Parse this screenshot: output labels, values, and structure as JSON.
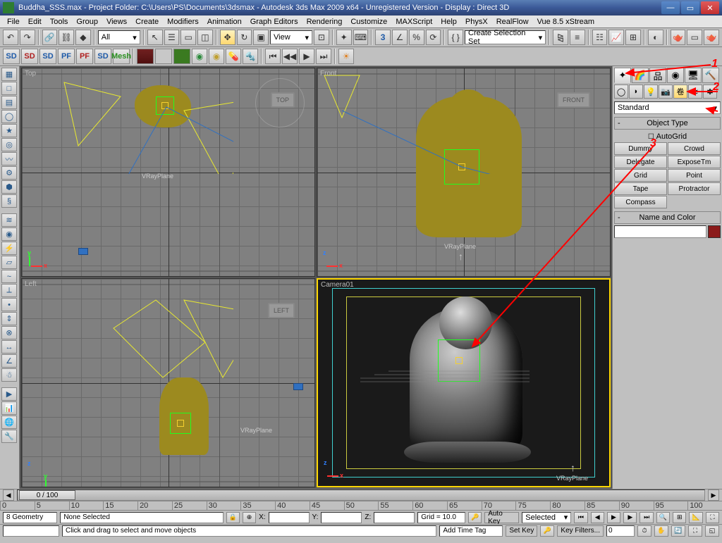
{
  "title": "Buddha_SSS.max     - Project Folder: C:\\Users\\PS\\Documents\\3dsmax  - Autodesk 3ds Max  2009 x64  - Unregistered Version       - Display : Direct 3D",
  "menus": [
    "File",
    "Edit",
    "Tools",
    "Group",
    "Views",
    "Create",
    "Modifiers",
    "Animation",
    "Graph Editors",
    "Rendering",
    "Customize",
    "MAXScript",
    "Help",
    "PhysX",
    "RealFlow",
    "Vue 8.5 xStream"
  ],
  "toolbar1": {
    "combo_all": "All",
    "combo_view": "View",
    "combo_selset": "Create Selection Set"
  },
  "toolbar2": {
    "sd": "SD",
    "sd2": "SD",
    "sd3": "SD",
    "pf": "PF",
    "pf2": "PF",
    "sd4": "SD",
    "mesh": "Mesh"
  },
  "viewports": {
    "top": {
      "label": "Top",
      "tag": "TOP",
      "obj": "VRayPlane"
    },
    "front": {
      "label": "Front",
      "tag": "FRONT",
      "obj": "VRayPlane"
    },
    "left": {
      "label": "Left",
      "tag": "LEFT",
      "obj": "VRayPlane"
    },
    "camera": {
      "label": "Camera01",
      "obj": "VRayPlane"
    }
  },
  "cmd_panel": {
    "combo": "Standard",
    "rollout1": "Object Type",
    "autogrid": "AutoGrid",
    "buttons": [
      "Dummy",
      "Crowd",
      "Delegate",
      "ExposeTm",
      "Grid",
      "Point",
      "Tape",
      "Protractor",
      "Compass",
      ""
    ],
    "rollout2": "Name and Color"
  },
  "timeline": {
    "handle": "0 / 100",
    "ticks": [
      "0",
      "5",
      "10",
      "15",
      "20",
      "25",
      "30",
      "35",
      "40",
      "45",
      "50",
      "55",
      "60",
      "65",
      "70",
      "75",
      "80",
      "85",
      "90",
      "95",
      "100"
    ]
  },
  "status": {
    "sel_count": "8 Geometry",
    "none_sel": "None Selected",
    "hint": "Click and drag to select and move objects",
    "x": "X:",
    "y": "Y:",
    "z": "Z:",
    "grid": "Grid = 10.0",
    "timetag": "Add Time Tag",
    "autokey": "Auto Key",
    "setkey": "Set Key",
    "selected": "Selected",
    "keyfilters": "Key Filters..."
  },
  "annotations": {
    "a1": "1",
    "a2": "2",
    "a3": "3"
  }
}
